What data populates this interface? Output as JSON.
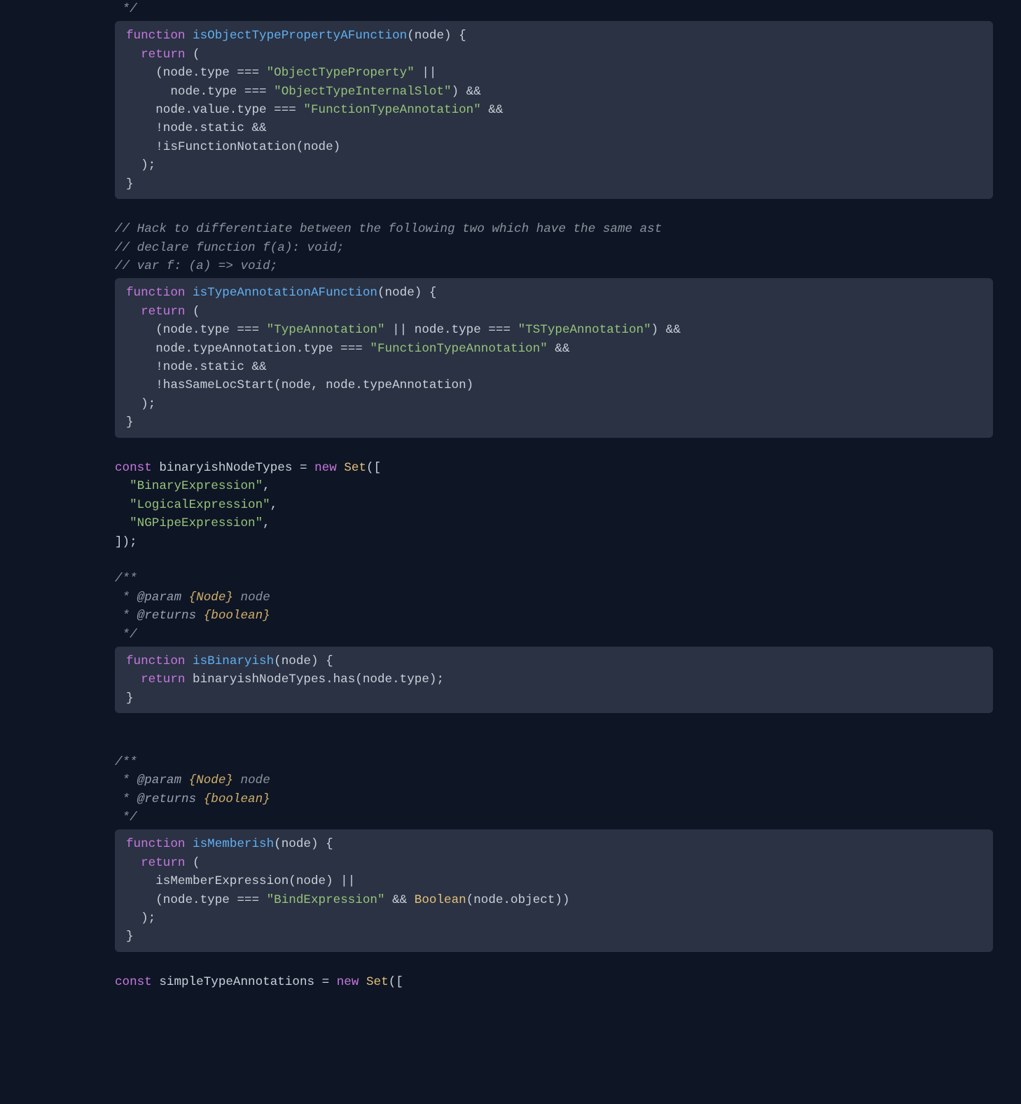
{
  "block1": {
    "jsdoc_end": " */",
    "l1_kw": "function",
    "l1_fn": "isObjectTypePropertyAFunction",
    "l1_params": "(node) {",
    "l2_kw": "  return",
    "l2_rest": " (",
    "l3_a": "    (node.type === ",
    "l3_s": "\"ObjectTypeProperty\"",
    "l3_b": " ||",
    "l4_a": "      node.type === ",
    "l4_s": "\"ObjectTypeInternalSlot\"",
    "l4_b": ") &&",
    "l5_a": "    node.value.type === ",
    "l5_s": "\"FunctionTypeAnnotation\"",
    "l5_b": " &&",
    "l6": "    !node.static &&",
    "l7": "    !isFunctionNotation(node)",
    "l8": "  );",
    "l9": "}"
  },
  "comments1": {
    "c1": "// Hack to differentiate between the following two which have the same ast",
    "c2": "// declare function f(a): void;",
    "c3": "// var f: (a) => void;"
  },
  "block2": {
    "l1_kw": "function",
    "l1_fn": "isTypeAnnotationAFunction",
    "l1_params": "(node) {",
    "l2_kw": "  return",
    "l2_rest": " (",
    "l3_a": "    (node.type === ",
    "l3_s1": "\"TypeAnnotation\"",
    "l3_b": " || node.type === ",
    "l3_s2": "\"TSTypeAnnotation\"",
    "l3_c": ") &&",
    "l4_a": "    node.typeAnnotation.type === ",
    "l4_s": "\"FunctionTypeAnnotation\"",
    "l4_b": " &&",
    "l5": "    !node.static &&",
    "l6": "    !hasSameLocStart(node, node.typeAnnotation)",
    "l7": "  );",
    "l8": "}"
  },
  "block3": {
    "l1_kw": "const",
    "l1_a": " binaryishNodeTypes = ",
    "l1_new": "new",
    "l1_b": " ",
    "l1_set": "Set",
    "l1_c": "([",
    "l2_a": "  ",
    "l2_s": "\"BinaryExpression\"",
    "l2_b": ",",
    "l3_a": "  ",
    "l3_s": "\"LogicalExpression\"",
    "l3_b": ",",
    "l4_a": "  ",
    "l4_s": "\"NGPipeExpression\"",
    "l4_b": ",",
    "l5": "]);"
  },
  "jsdoc1": {
    "start": "/**",
    "star": " * ",
    "param": "@param",
    "paramtype": " {Node} ",
    "paramname": "node",
    "returns": "@returns",
    "returnstype": " {boolean}",
    "end": " */"
  },
  "block4": {
    "l1_kw": "function",
    "l1_fn": "isBinaryish",
    "l1_params": "(node) {",
    "l2_kw": "  return",
    "l2_rest": " binaryishNodeTypes.has(node.type);",
    "l3": "}"
  },
  "jsdoc2": {
    "start": "/**",
    "star": " * ",
    "param": "@param",
    "paramtype": " {Node} ",
    "paramname": "node",
    "returns": "@returns",
    "returnstype": " {boolean}",
    "end": " */"
  },
  "block5": {
    "l1_kw": "function",
    "l1_fn": "isMemberish",
    "l1_params": "(node) {",
    "l2_kw": "  return",
    "l2_rest": " (",
    "l3": "    isMemberExpression(node) ||",
    "l4_a": "    (node.type === ",
    "l4_s": "\"BindExpression\"",
    "l4_b": " && ",
    "l4_bool": "Boolean",
    "l4_c": "(node.object))",
    "l5": "  );",
    "l6": "}"
  },
  "block6": {
    "l1_kw": "const",
    "l1_a": " simpleTypeAnnotations = ",
    "l1_new": "new",
    "l1_b": " ",
    "l1_set": "Set",
    "l1_c": "(["
  }
}
